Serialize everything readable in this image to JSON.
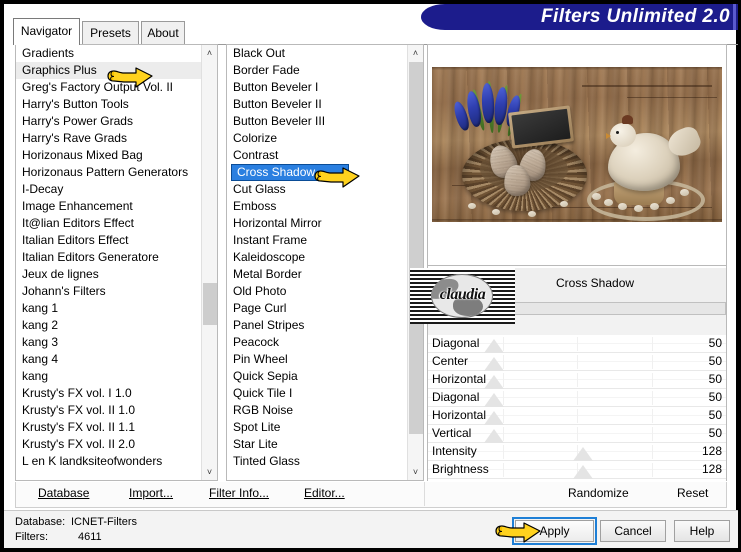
{
  "window": {
    "title": "Filters Unlimited 2.0"
  },
  "tabs": [
    {
      "label": "Navigator",
      "active": true
    },
    {
      "label": "Presets",
      "active": false
    },
    {
      "label": "About",
      "active": false
    }
  ],
  "navigator_list": {
    "name": "filter-category-list",
    "selected": "Graphics Plus",
    "items": [
      "Gradients",
      "Graphics Plus",
      "Greg's Factory Output Vol. II",
      "Harry's Button Tools",
      "Harry's Power Grads",
      "Harry's Rave Grads",
      "Horizonaus Mixed Bag",
      "Horizonaus Pattern Generators",
      "I-Decay",
      "Image Enhancement",
      "It@lian Editors Effect",
      "Italian Editors Effect",
      "Italian Editors Generatore",
      "Jeux de lignes",
      "Johann's Filters",
      "kang 1",
      "kang 2",
      "kang 3",
      "kang 4",
      "kang",
      "Krusty's FX vol. I 1.0",
      "Krusty's FX vol. II 1.0",
      "Krusty's FX vol. II 1.1",
      "Krusty's FX vol. II 2.0",
      "L en K landksiteofwonders"
    ]
  },
  "effects_list": {
    "name": "filter-effect-list",
    "selected": "Cross Shadow",
    "items": [
      "Black Out",
      "Border Fade",
      "Button Beveler I",
      "Button Beveler II",
      "Button Beveler III",
      "Colorize",
      "Contrast",
      "Cross Shadow",
      "Cut Glass",
      "Emboss",
      "Horizontal Mirror",
      "Instant Frame",
      "Kaleidoscope",
      "Metal Border",
      "Old Photo",
      "Page Curl",
      "Panel Stripes",
      "Peacock",
      "Pin Wheel",
      "Quick Sepia",
      "Quick Tile I",
      "RGB Noise",
      "Spot Lite",
      "Star Lite",
      "Tinted Glass"
    ]
  },
  "watermark": {
    "text": "claudia"
  },
  "filter_panel": {
    "title": "Cross Shadow",
    "sliders": [
      {
        "label": "Diagonal",
        "value": "50",
        "pos_pct": 22
      },
      {
        "label": "Center",
        "value": "50",
        "pos_pct": 22
      },
      {
        "label": "Horizontal",
        "value": "50",
        "pos_pct": 22
      },
      {
        "label": "Diagonal",
        "value": "50",
        "pos_pct": 22
      },
      {
        "label": "Horizontal",
        "value": "50",
        "pos_pct": 22
      },
      {
        "label": "Vertical",
        "value": "50",
        "pos_pct": 22
      },
      {
        "label": "Intensity",
        "value": "128",
        "pos_pct": 52
      },
      {
        "label": "Brightness",
        "value": "128",
        "pos_pct": 52
      }
    ]
  },
  "action_bar": {
    "database": "Database",
    "import": "Import...",
    "filter_info": "Filter Info...",
    "editor": "Editor...",
    "randomize": "Randomize",
    "reset": "Reset"
  },
  "status": {
    "database_label": "Database:",
    "database_value": "ICNET-Filters",
    "filters_label": "Filters:",
    "filters_value": "4611"
  },
  "buttons": {
    "apply": "Apply",
    "cancel": "Cancel",
    "help": "Help"
  },
  "scrollbars": {
    "up_glyph": "˄",
    "down_glyph": "˅"
  },
  "colors": {
    "title_banner": "#1c1c8c",
    "selection_blue": "#2a7fe0",
    "focus_blue": "#1e7fd6",
    "hand_yellow": "#ffd21e"
  }
}
